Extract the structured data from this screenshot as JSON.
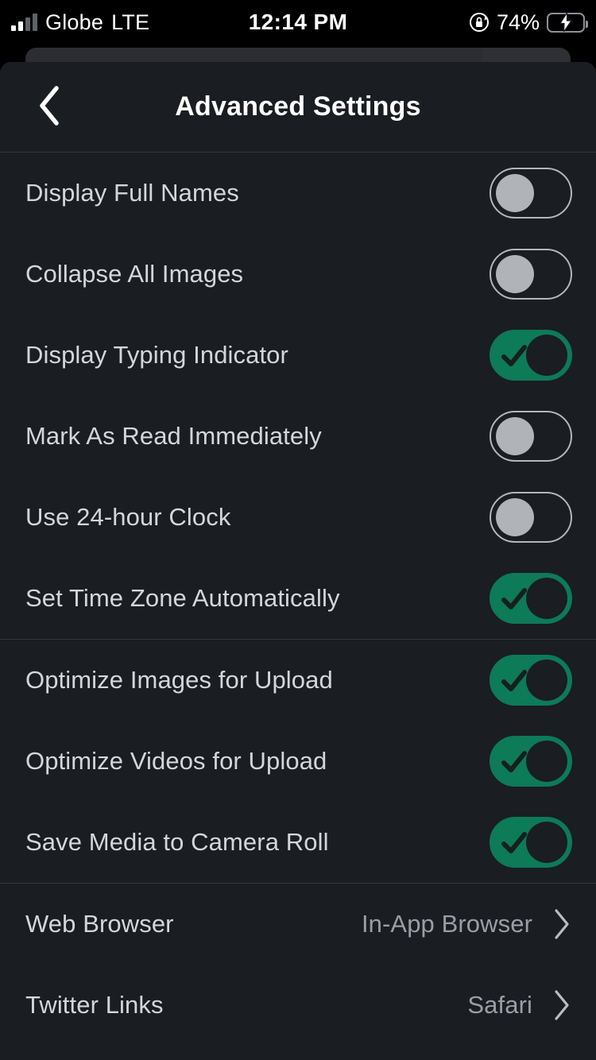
{
  "status_bar": {
    "carrier": "Globe",
    "network": "LTE",
    "time": "12:14 PM",
    "battery_percent": "74%",
    "battery_level": 74,
    "charging": true,
    "rotation_lock": true,
    "signal_bars": 2,
    "signal_bars_total": 4,
    "icons": {
      "signal": "signal-bars-icon",
      "rotation_lock": "rotation-lock-icon",
      "battery": "battery-charging-icon"
    }
  },
  "header": {
    "title": "Advanced Settings",
    "back_icon": "chevron-left-icon"
  },
  "colors": {
    "screen_background": "#000000",
    "sheet_background": "#1a1d22",
    "toggle_on": "#0d7a58",
    "toggle_off_border": "#b3b7bb",
    "toggle_off_knob": "#b0b4b8",
    "label_text": "#d3d7da",
    "value_text": "#9b9fa4",
    "divider": "#34383d",
    "battery_green": "#31d158"
  },
  "sections": [
    {
      "name": "display-section",
      "rows": [
        {
          "label": "Display Full Names",
          "type": "toggle",
          "value": "off",
          "name": "display-full-names"
        },
        {
          "label": "Collapse All Images",
          "type": "toggle",
          "value": "off",
          "name": "collapse-all-images"
        },
        {
          "label": "Display Typing Indicator",
          "type": "toggle",
          "value": "on",
          "name": "display-typing-indicator"
        },
        {
          "label": "Mark As Read Immediately",
          "type": "toggle",
          "value": "off",
          "name": "mark-as-read-immediately"
        },
        {
          "label": "Use 24-hour Clock",
          "type": "toggle",
          "value": "off",
          "name": "use-24-hour-clock"
        },
        {
          "label": "Set Time Zone Automatically",
          "type": "toggle",
          "value": "on",
          "name": "set-time-zone-automatically"
        }
      ]
    },
    {
      "name": "media-section",
      "rows": [
        {
          "label": "Optimize Images for Upload",
          "type": "toggle",
          "value": "on",
          "name": "optimize-images-for-upload"
        },
        {
          "label": "Optimize Videos for Upload",
          "type": "toggle",
          "value": "on",
          "name": "optimize-videos-for-upload"
        },
        {
          "label": "Save Media to Camera Roll",
          "type": "toggle",
          "value": "on",
          "name": "save-media-to-camera-roll"
        }
      ]
    },
    {
      "name": "links-section",
      "rows": [
        {
          "label": "Web Browser",
          "type": "disclosure",
          "value": "In-App Browser",
          "name": "web-browser"
        },
        {
          "label": "Twitter Links",
          "type": "disclosure",
          "value": "Safari",
          "name": "twitter-links"
        }
      ]
    }
  ]
}
